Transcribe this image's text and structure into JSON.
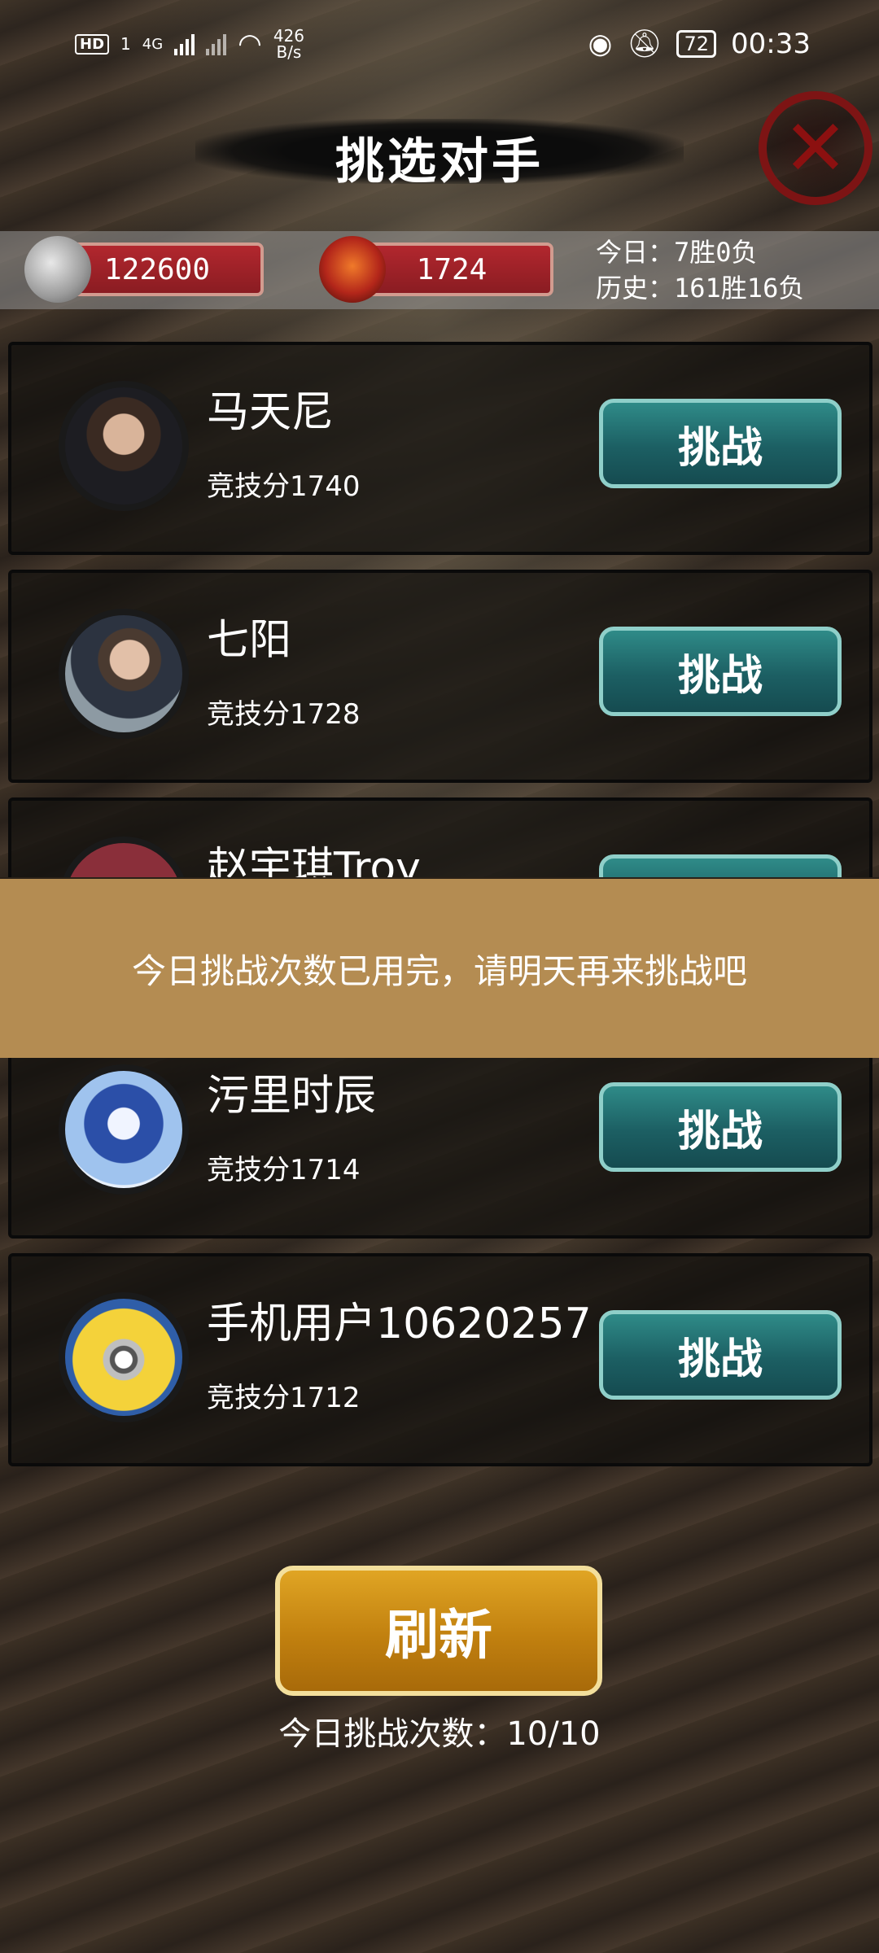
{
  "status_bar": {
    "network_hd": "HD",
    "network_sim": "1",
    "network_gen": "4G",
    "speed_value": "426",
    "speed_unit": "B/s",
    "battery": "72",
    "time": "00:33"
  },
  "header": {
    "title": "挑选对手"
  },
  "resources": {
    "coins": "122600",
    "rank_points": "1724",
    "today_record": "今日：7胜0负",
    "history_record": "历史：161胜16负"
  },
  "opponents": [
    {
      "name": "马天尼",
      "score": "竞技分1740",
      "button": "挑战"
    },
    {
      "name": "七阳",
      "score": "竞技分1728",
      "button": "挑战"
    },
    {
      "name": "赵宇琪Troy",
      "score": "",
      "button": "挑战"
    },
    {
      "name": "污里时辰",
      "score": "竞技分1714",
      "button": "挑战"
    },
    {
      "name": "手机用户10620257",
      "score": "竞技分1712",
      "button": "挑战"
    }
  ],
  "toast": {
    "message": "今日挑战次数已用完，请明天再来挑战吧"
  },
  "footer": {
    "refresh_label": "刷新",
    "daily_challenges": "今日挑战次数：10/10"
  },
  "colors": {
    "challenge_button": "#1f6a6d",
    "refresh_button": "#d39a1c",
    "toast_bg": "#b48c52",
    "pill_red": "#a3232a"
  }
}
